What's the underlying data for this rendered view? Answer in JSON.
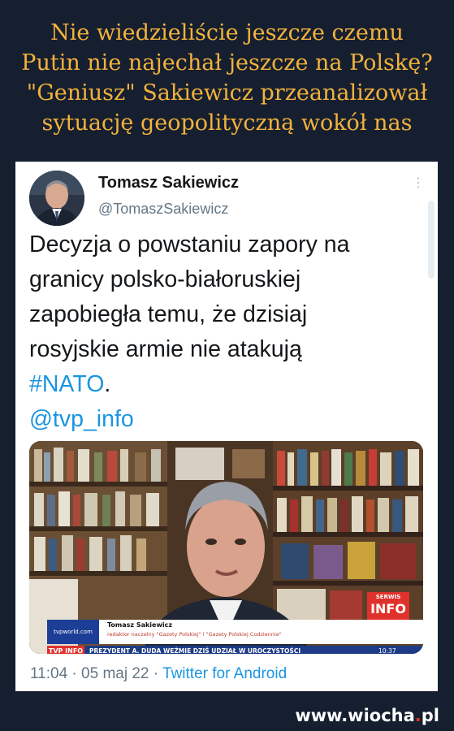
{
  "headline": {
    "lines": [
      "Nie wiedzieliście jeszcze czemu",
      "Putin nie najechał jeszcze na Polskę?",
      "\"Geniusz\" Sakiewicz przeanalizował",
      "sytuację geopolityczną wokół nas"
    ]
  },
  "tweet": {
    "author_name": "Tomasz Sakiewicz",
    "author_handle": "@TomaszSakiewicz",
    "text_lines": [
      "Decyzja o powstaniu zapory na",
      "granicy polsko-białoruskiej",
      "zapobiegła temu, że dzisiaj",
      "rosyjskie armie nie atakują"
    ],
    "hashtag": "#NATO",
    "hashtag_suffix": ".",
    "mention": "@tvp_info",
    "time": "11:04",
    "separator": " · ",
    "date": "05 maj 22",
    "source_app": "Twitter for Android"
  },
  "media": {
    "channel_site": "tvpworld.com",
    "lower_third_name": "Tomasz Sakiewicz",
    "lower_third_role": "redaktor naczelny \"Gazety Polskiej\" i \"Gazety Polskiej Codziennie\"",
    "ticker_logo": "TVP INFO",
    "ticker_text": "PREZYDENT A. DUDA WEŹMIE DZIŚ UDZIAŁ W UROCZYSTOŚCI",
    "ticker_time": "10:37",
    "badge_top": "SERWIS",
    "badge_bottom": "INFO"
  },
  "watermark": {
    "prefix": "www.wiocha",
    "dot": ".",
    "suffix": "pl"
  },
  "colors": {
    "background": "#161f2f",
    "headline": "#f2b23c",
    "link": "#1b95e0",
    "muted": "#657786"
  }
}
